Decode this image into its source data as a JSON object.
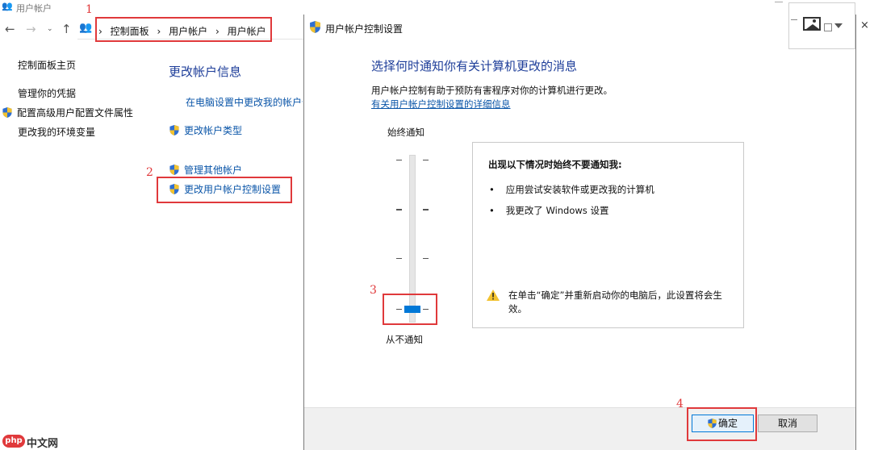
{
  "window": {
    "title": "用户帐户",
    "breadcrumb": [
      "控制面板",
      "用户帐户",
      "用户帐户"
    ]
  },
  "left_pane": {
    "items": [
      "控制面板主页",
      "管理你的凭据",
      "配置高级用户配置文件属性",
      "更改我的环境变量"
    ]
  },
  "main": {
    "title": "更改帐户信息",
    "links": [
      "在电脑设置中更改我的帐户信",
      "更改帐户类型",
      "管理其他帐户",
      "更改用户帐户控制设置"
    ]
  },
  "dialog": {
    "title": "用户帐户控制设置",
    "heading": "选择何时通知你有关计算机更改的消息",
    "description": "用户帐户控制有助于预防有害程序对你的计算机进行更改。",
    "link": "有关用户帐户控制设置的详细信息",
    "slider_top_label": "始终通知",
    "slider_bottom_label": "从不通知",
    "slider_level": "1 of 4 (lowest)",
    "info_title": "出现以下情况时始终不要通知我:",
    "info_bullets": [
      "应用尝试安装软件或更改我的计算机",
      "我更改了 Windows 设置"
    ],
    "warning": [
      "在单击“确定”并重新启动你的电脑后，此设置将会生",
      "效。"
    ],
    "ok_button": "确定",
    "cancel_button": "取消"
  },
  "annotations": [
    "1",
    "2",
    "3",
    "4"
  ],
  "watermark": {
    "brand": "php",
    "text": "中文网"
  },
  "colors": {
    "annotation_red": "#e0393b",
    "link_blue": "#0a55a8",
    "heading_blue": "#1d3d99",
    "slider_thumb": "#0078d7"
  }
}
